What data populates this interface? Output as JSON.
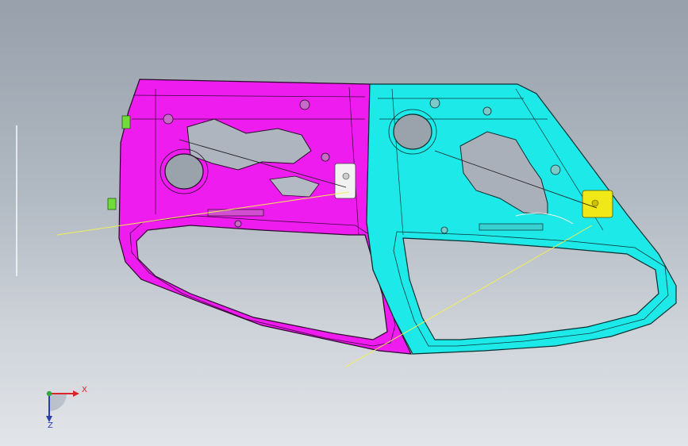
{
  "viewport": {
    "background_top": "#97a0ab",
    "background_bottom": "#e2e5e9"
  },
  "parts": {
    "left_door_panel": {
      "color": "#ee1cee"
    },
    "right_door_panel": {
      "color": "#1de9e9"
    },
    "left_door_latch": {
      "color": "#f2f2f2"
    },
    "right_door_latch": {
      "color": "#f1e817"
    },
    "hinge_brackets": {
      "color": "#6fdc3a"
    },
    "sketch_lines": {
      "color": "#f2ef55"
    },
    "cable_lines": {
      "color": "#222222"
    }
  },
  "triad": {
    "x_label": "X",
    "y_label": "Z",
    "x_color": "#d8262a",
    "z_color": "#2b3da8",
    "origin_color": "#2fa83c"
  }
}
